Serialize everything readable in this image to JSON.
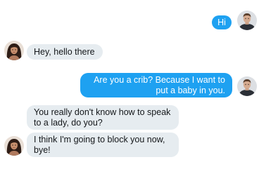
{
  "conversation": {
    "messages": [
      {
        "sender": "man",
        "text": "Hi"
      },
      {
        "sender": "woman",
        "text": "Hey, hello there"
      },
      {
        "sender": "man",
        "text": "Are you a crib? Because I want to put a baby in you."
      },
      {
        "sender": "woman",
        "text": "You really don't know how to speak to a lady, do you?"
      },
      {
        "sender": "woman",
        "text": "I think I'm going to block you now, bye!"
      }
    ]
  },
  "colors": {
    "outgoing_bubble": "#1ea1f1",
    "incoming_bubble": "#e6ecf0",
    "outgoing_text": "#ffffff",
    "incoming_text": "#14171a"
  },
  "avatars": {
    "man": "man-avatar-icon",
    "woman": "woman-avatar-icon"
  }
}
